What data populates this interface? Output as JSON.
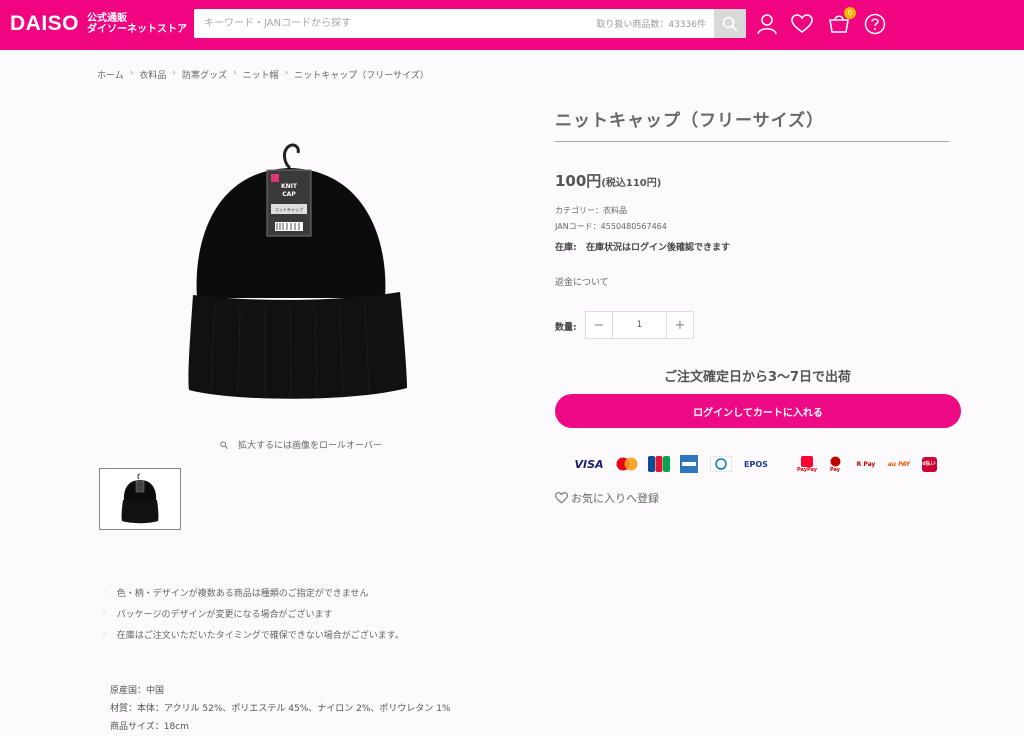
{
  "header": {
    "logo_mark": "DAISO",
    "logo_sub1": "公式通販",
    "logo_sub2": "ダイソーネットストア",
    "search_placeholder": "キーワード・JANコードから探す",
    "item_count": "取り扱い商品数：43336件",
    "cart_badge": "0",
    "icons": [
      "search-icon",
      "user-icon",
      "heart-icon",
      "cart-icon",
      "help-icon"
    ]
  },
  "breadcrumb": [
    "ホーム",
    "衣料品",
    "防寒グッズ",
    "ニット帽",
    "ニットキャップ（フリーサイズ）"
  ],
  "gallery": {
    "zoom_hint": "拡大するには画像をロールオーバー",
    "tag_lines": [
      "KNIT",
      "CAP",
      "ニットキャップ"
    ]
  },
  "product": {
    "title": "ニットキャップ（フリーサイズ）",
    "price_main": "100円",
    "price_tax": "(税込110円)",
    "category": "カテゴリー：衣料品",
    "jan": "JANコード：4550480567464",
    "stock_label": "在庫:",
    "stock_text": "在庫状況はログイン後確認できます",
    "refund": "返金について",
    "qty_label": "数量:",
    "qty_value": "1",
    "qty_minus": "−",
    "qty_plus": "+",
    "shipping": "ご注文確定日から3〜7日で出荷",
    "cart_button": "ログインしてカートに入れる",
    "favorite": "お気に入りへ登録"
  },
  "payments": [
    "VISA",
    "Mastercard",
    "JCB",
    "AMEX",
    "Diners",
    "EPOS",
    "PayPay",
    "Rakuten Pay",
    "R Pay",
    "au PAY",
    "d払い"
  ],
  "payment_labels": {
    "visa": "VISA",
    "epos": "EPOS",
    "paypay": "PayPay",
    "rpay": "R Pay",
    "aupay": "au PAY",
    "dpay": "d払い",
    "pay": "Pay"
  },
  "notes": [
    "色・柄・デザインが複数ある商品は種類のご指定ができません",
    "パッケージのデザインが変更になる場合がございます",
    "在庫はご注文いただいたタイミングで確保できない場合がございます。"
  ],
  "specs": [
    "原産国：中国",
    "材質：本体：アクリル 52%、ポリエステル 45%、ナイロン 2%、ポリウレタン 1%",
    "商品サイズ：18cm"
  ],
  "colors": {
    "brand": "#f0047f",
    "button": "#ef0a85",
    "badge": "#f7b500"
  }
}
